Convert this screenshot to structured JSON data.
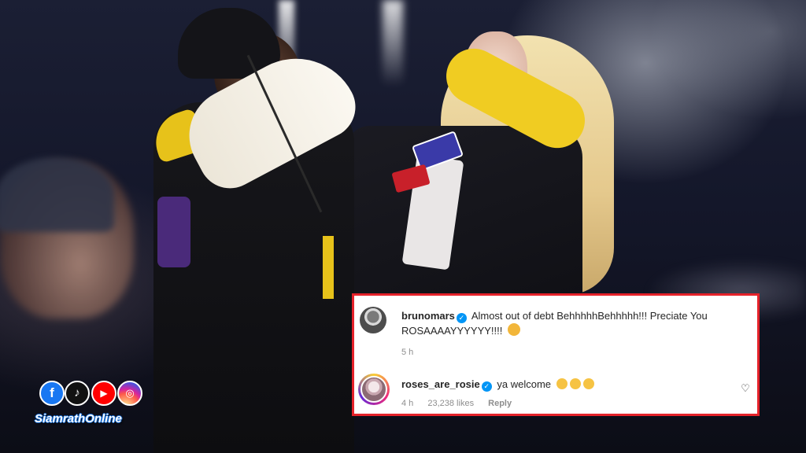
{
  "photo": {
    "description_icon": "concert-photo-icon",
    "colors": {
      "background": "#14172a",
      "accent_yellow": "#e7c21a",
      "highlight_border": "#e5222a"
    }
  },
  "comments": [
    {
      "username": "brunomars",
      "verified": true,
      "text": "Almost out of debt BehhhhhBehhhhh!!! Preciate You ROSAAAAYYYYYY!!!!",
      "emoji_icon": "hugging-face-icon",
      "time": "5 h",
      "likes": "",
      "reply_label": ""
    },
    {
      "username": "roses_are_rosie",
      "verified": true,
      "text": "ya welcome",
      "emoji_icon": "relieved-face-icon",
      "time": "4 h",
      "likes": "23,238 likes",
      "reply_label": "Reply"
    }
  ],
  "brand": {
    "name": "SiamrathOnline",
    "social_icons": [
      "facebook-icon",
      "tiktok-icon",
      "youtube-icon",
      "instagram-icon"
    ]
  }
}
